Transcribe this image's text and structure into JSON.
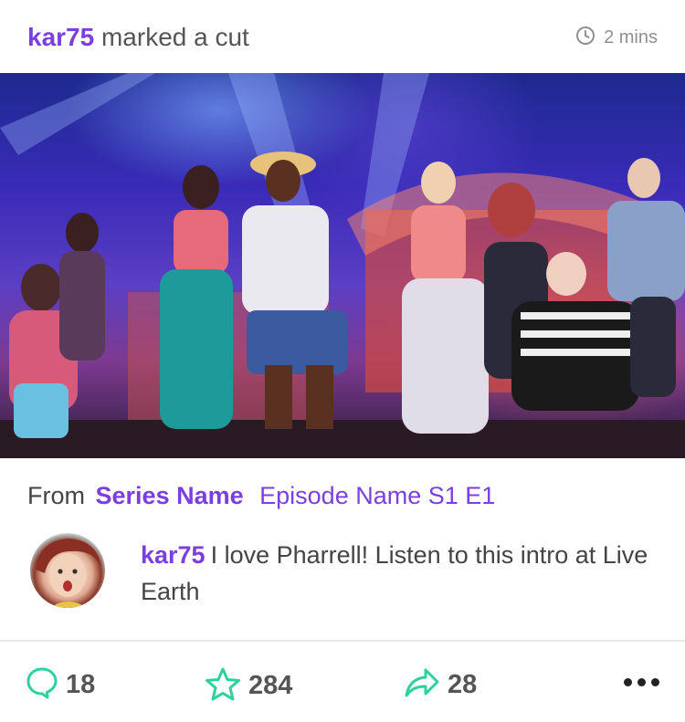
{
  "post": {
    "username": "kar75",
    "action": "marked a cut",
    "time": "2 mins"
  },
  "media": {
    "image_description": "concert performers on stage",
    "alt": "media-image"
  },
  "source": {
    "from_label": "From",
    "series": "Series Name",
    "episode": "Episode Name S1 E1"
  },
  "comment": {
    "username": "kar75",
    "text": "I love Pharrell! Listen to this intro at Live Earth"
  },
  "actions": {
    "comments": "18",
    "favorites": "284",
    "shares": "28"
  },
  "colors": {
    "accent": "#7b3fe0",
    "action_icons": "#2fd0a0",
    "muted": "#8f8f8f"
  },
  "icons": {
    "time": "clock-icon",
    "comment": "comment-bubble-icon",
    "favorite": "star-icon",
    "share": "share-arrow-icon",
    "more": "more-dots-icon"
  }
}
